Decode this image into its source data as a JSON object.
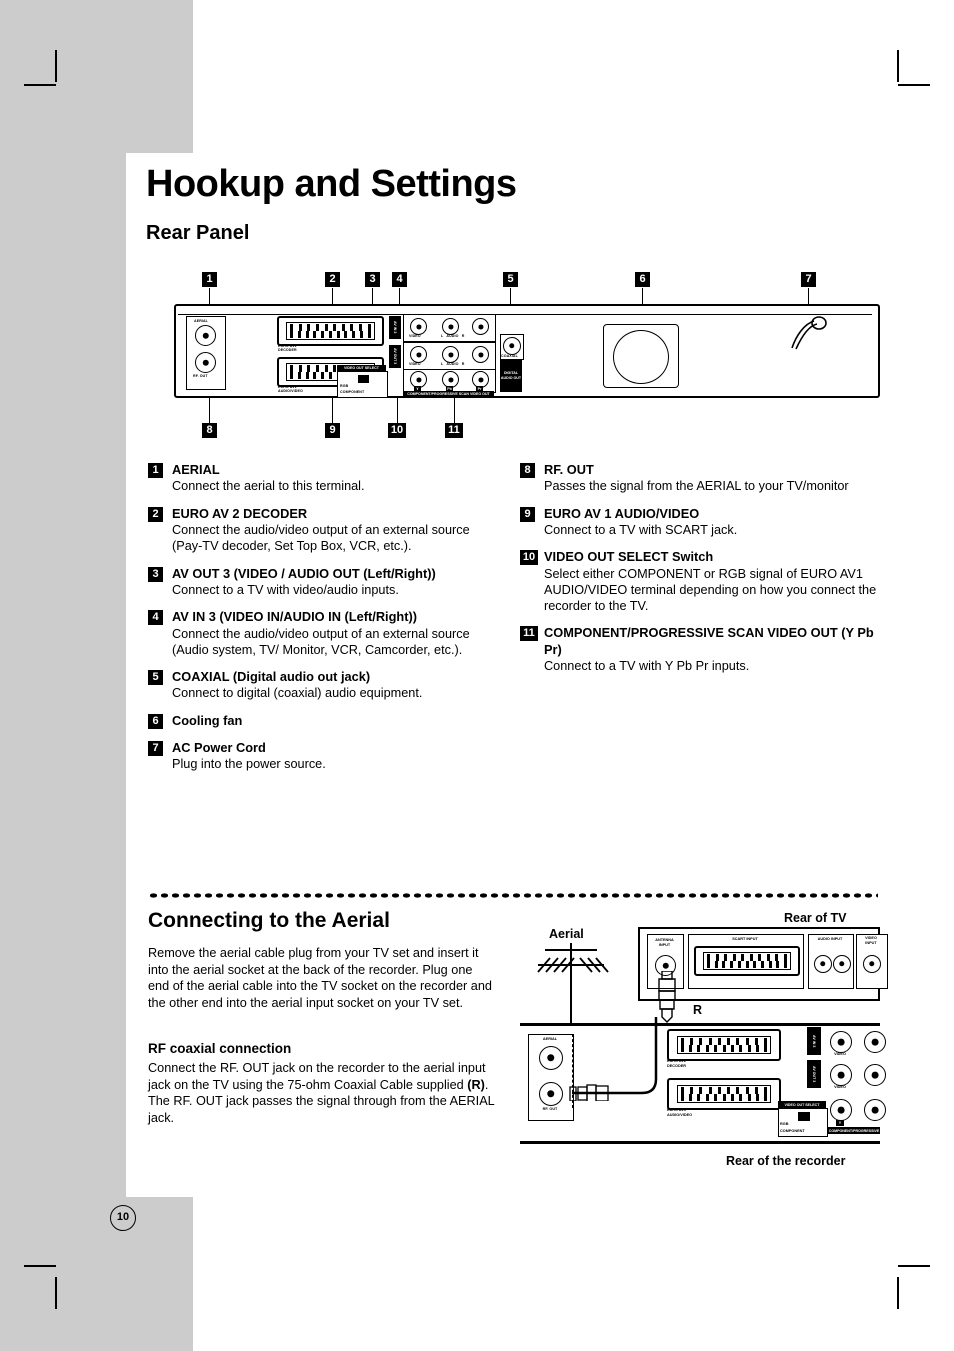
{
  "page": {
    "title": "Hookup and Settings",
    "section_title": "Rear Panel",
    "page_number": "10"
  },
  "rear_panel_figure": {
    "callouts_top": [
      "1",
      "2",
      "3",
      "4",
      "5",
      "6",
      "7"
    ],
    "callouts_bottom": [
      "8",
      "9",
      "10",
      "11"
    ],
    "panel_labels": {
      "aerial": "AERIAL",
      "rf_out": "RF. OUT",
      "euro_av2": "EURO AV2\nDECODER",
      "euro_av1": "EURO AV1\nAUDIO/VIDEO",
      "av_in_3": "AV IN 3",
      "av_out_3": "AV OUT 3",
      "video": "VIDEO",
      "audio_lr": "L   AUDIO   R",
      "coaxial": "COAXIAL",
      "digital_audio_out": "DIGITAL\nAUDIO\nOUT",
      "video_out_select": "VIDEO OUT SELECT",
      "rgb": "RGB",
      "component": "COMPONENT",
      "component_out": "COMPONENT/PROGRESSIVE SCAN VIDEO OUT",
      "ypbpr": [
        "Y",
        "Pb",
        "Pr"
      ]
    }
  },
  "descriptions": {
    "left": [
      {
        "num": "1",
        "title": "AERIAL",
        "body": "Connect the aerial to this terminal."
      },
      {
        "num": "2",
        "title": "EURO AV 2 DECODER",
        "body": "Connect the audio/video output of an external source (Pay-TV decoder, Set Top Box, VCR, etc.)."
      },
      {
        "num": "3",
        "title": "AV OUT 3 (VIDEO / AUDIO OUT (Left/Right))",
        "body": "Connect to a TV with video/audio inputs."
      },
      {
        "num": "4",
        "title": "AV IN 3 (VIDEO IN/AUDIO IN (Left/Right))",
        "body": "Connect the audio/video output of an external source (Audio system, TV/ Monitor, VCR, Camcorder, etc.)."
      },
      {
        "num": "5",
        "title": "COAXIAL (Digital audio out jack)",
        "body": "Connect to digital (coaxial) audio equipment."
      },
      {
        "num": "6",
        "title": "Cooling fan",
        "body": ""
      },
      {
        "num": "7",
        "title": "AC Power Cord",
        "body": "Plug into the power source."
      }
    ],
    "right": [
      {
        "num": "8",
        "title": "RF. OUT",
        "body": "Passes the signal from the AERIAL to your TV/monitor"
      },
      {
        "num": "9",
        "title": "EURO AV 1 AUDIO/VIDEO",
        "body": "Connect to a TV with SCART jack."
      },
      {
        "num": "10",
        "title": "VIDEO OUT SELECT Switch",
        "body": "Select either COMPONENT or RGB signal of EURO AV1 AUDIO/VIDEO terminal depending on how you connect the recorder to the TV."
      },
      {
        "num": "11",
        "title": "COMPONENT/PROGRESSIVE SCAN VIDEO OUT (Y Pb Pr)",
        "body": "Connect to a TV with Y Pb Pr inputs."
      }
    ]
  },
  "aerial_section": {
    "title": "Connecting to the Aerial",
    "body": "Remove the aerial cable plug from your TV set and insert it into the aerial socket at the back of the recorder. Plug one end of the aerial cable into the TV socket on the recorder and the other end into the aerial input socket on your TV set.",
    "rf_title": "RF coaxial connection",
    "rf_body_1": "Connect the RF. OUT jack on the recorder to the aerial input jack on the TV using the 75-ohm Coaxial Cable supplied ",
    "rf_bold": "(R)",
    "rf_body_2": ". The RF. OUT jack passes the signal through from the AERIAL jack."
  },
  "hookup_figure": {
    "aerial_label": "Aerial",
    "rear_of_tv": "Rear of TV",
    "rear_of_recorder": "Rear of the recorder",
    "cable_label": "R",
    "tv_labels": {
      "antenna_input": "ANTENNA\nINPUT",
      "scart_input": "SCART INPUT",
      "audio_input": "AUDIO INPUT",
      "video_input": "VIDEO\nINPUT"
    },
    "recorder_labels": {
      "aerial": "AERIAL",
      "rf_out": "RF. OUT",
      "euro_av2": "EURO AV2\nDECODER",
      "euro_av1": "EURO AV1\nAUDIO/VIDEO",
      "video_out_select": "VIDEO OUT SELECT",
      "rgb": "RGB",
      "component": "COMPONENT",
      "av_in_3": "AV IN 3",
      "av_out_3": "AV OUT 3",
      "video": "VIDEO",
      "component_out": "COMPONENT/PROGRESSIVE"
    }
  },
  "colors": {
    "page_bg": "#ffffff",
    "bleed_gray": "#cccccc",
    "ink": "#000000"
  }
}
